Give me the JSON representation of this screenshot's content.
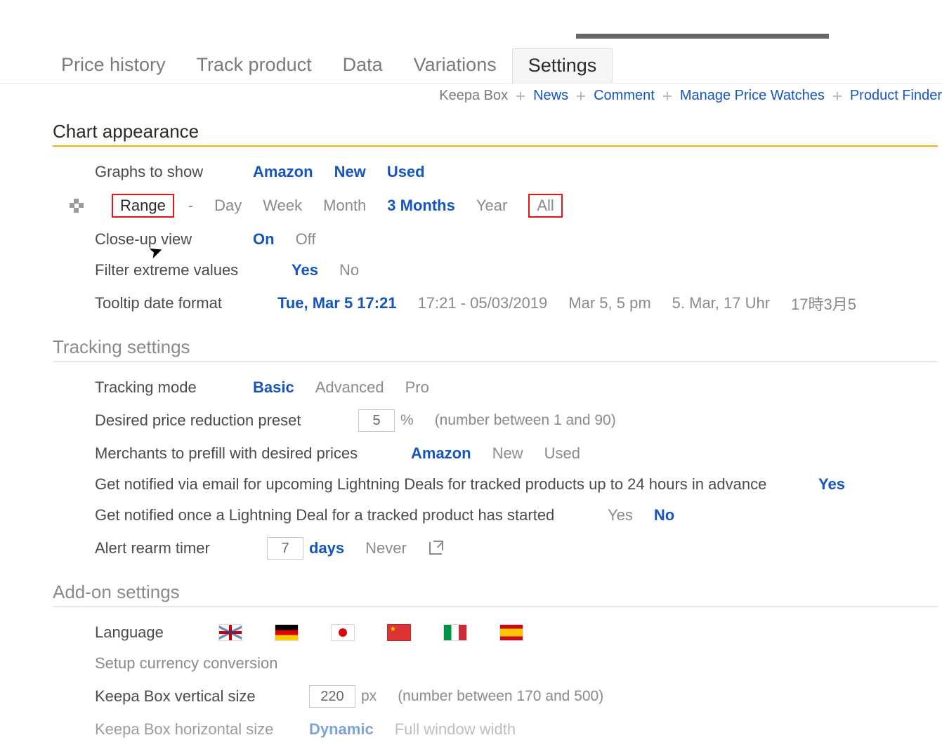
{
  "tabs": {
    "items": [
      "Price history",
      "Track product",
      "Data",
      "Variations",
      "Settings"
    ],
    "active": "Settings"
  },
  "sublinks": {
    "plain": "Keepa Box",
    "items": [
      "News",
      "Comment",
      "Manage Price Watches",
      "Product Finder"
    ]
  },
  "sections": {
    "chart": {
      "title": "Chart appearance",
      "graphs_label": "Graphs to show",
      "graphs_opts": [
        "Amazon",
        "New",
        "Used"
      ],
      "range_label": "Range",
      "range_opts": [
        "Day",
        "Week",
        "Month",
        "3 Months",
        "Year",
        "All"
      ],
      "range_selected": "3 Months",
      "closeup_label": "Close-up view",
      "closeup_opts": [
        "On",
        "Off"
      ],
      "closeup_selected": "On",
      "filter_label": "Filter extreme values",
      "filter_opts": [
        "Yes",
        "No"
      ],
      "filter_selected": "Yes",
      "tooltipfmt_label": "Tooltip date format",
      "tooltip_opts": [
        "Tue, Mar 5 17:21",
        "17:21 - 05/03/2019",
        "Mar 5, 5 pm",
        "5. Mar, 17 Uhr",
        "17時3月5"
      ],
      "tooltip_selected": "Tue, Mar 5 17:21"
    },
    "tracking": {
      "title": "Tracking settings",
      "mode_label": "Tracking mode",
      "mode_opts": [
        "Basic",
        "Advanced",
        "Pro"
      ],
      "mode_selected": "Basic",
      "reduction_label": "Desired price reduction preset",
      "reduction_value": "5",
      "reduction_unit": "%",
      "reduction_help": "(number between 1 and 90)",
      "merchants_label": "Merchants to prefill with desired prices",
      "merchants_opts": [
        "Amazon",
        "New",
        "Used"
      ],
      "merchants_selected": "Amazon",
      "lightning_email_label": "Get notified via email for upcoming Lightning Deals for tracked products up to 24 hours in advance",
      "lightning_email_opts": [
        "Yes"
      ],
      "lightning_email_selected": "Yes",
      "lightning_started_label": "Get notified once a Lightning Deal for a tracked product has started",
      "lightning_started_opts": [
        "Yes",
        "No"
      ],
      "lightning_started_selected": "No",
      "rearm_label": "Alert rearm timer",
      "rearm_value": "7",
      "rearm_unit": "days",
      "rearm_never": "Never"
    },
    "addon": {
      "title": "Add-on settings",
      "language_label": "Language",
      "flag_names": [
        "flag-uk",
        "flag-de",
        "flag-jp",
        "flag-cn",
        "flag-it",
        "flag-es"
      ],
      "currency_label": "Setup currency conversion",
      "vsize_label": "Keepa Box vertical size",
      "vsize_value": "220",
      "vsize_unit": "px",
      "vsize_help": "(number between 170 and 500)",
      "hsize_label": "Keepa Box horizontal size",
      "hsize_opts": [
        "Dynamic",
        "Full window width"
      ],
      "hsize_selected": "Dynamic"
    }
  }
}
